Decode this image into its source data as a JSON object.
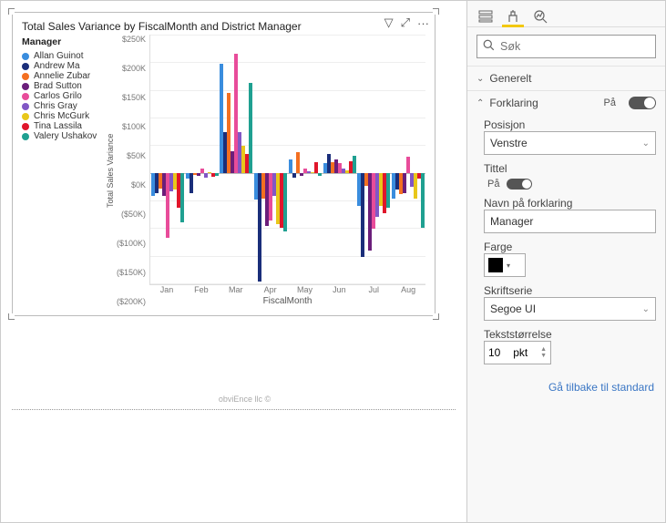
{
  "chart": {
    "title": "Total Sales Variance by FiscalMonth and District Manager",
    "legend_title": "Manager",
    "y_axis_label": "Total Sales Variance",
    "x_axis_label": "FiscalMonth",
    "toolbar": {
      "filter": "▽",
      "focus": "⤢",
      "more": "···"
    },
    "footer": "obviEnce llc ©"
  },
  "chart_data": {
    "type": "bar",
    "categories": [
      "Jan",
      "Feb",
      "Mar",
      "Apr",
      "May",
      "Jun",
      "Jul",
      "Aug"
    ],
    "x_label": "FiscalMonth",
    "y_label": "Total Sales Variance",
    "ylim": [
      -200000,
      250000
    ],
    "y_ticks": [
      "$250K",
      "$200K",
      "$150K",
      "$100K",
      "$50K",
      "$0K",
      "($50K)",
      "($100K)",
      "($150K)",
      "($200K)"
    ],
    "series": [
      {
        "name": "Allan Guinot",
        "color": "#3A8DDE",
        "values": [
          -40000,
          -10000,
          198000,
          -48000,
          25000,
          18000,
          -59000,
          -45000
        ]
      },
      {
        "name": "Andrew Ma",
        "color": "#1A2E7A",
        "values": [
          -35000,
          -35000,
          75000,
          -195000,
          -8000,
          35000,
          -150000,
          -30000
        ]
      },
      {
        "name": "Annelie Zubar",
        "color": "#F36F21",
        "values": [
          -28000,
          -3000,
          145000,
          -45000,
          38000,
          20000,
          -22000,
          -38000
        ]
      },
      {
        "name": "Brad Sutton",
        "color": "#6B1E7A",
        "values": [
          -40000,
          -5000,
          40000,
          -95000,
          -5000,
          25000,
          -140000,
          -35000
        ]
      },
      {
        "name": "Carlos Grilo",
        "color": "#E84C9A",
        "values": [
          -116000,
          8000,
          215000,
          -85000,
          8000,
          18000,
          -100000,
          30000
        ]
      },
      {
        "name": "Chris Gray",
        "color": "#8157C5",
        "values": [
          -32000,
          -8000,
          75000,
          -40000,
          3000,
          8000,
          -78000,
          -25000
        ]
      },
      {
        "name": "Chris McGurk",
        "color": "#E8C71A",
        "values": [
          -30000,
          2000,
          50000,
          -92000,
          2000,
          5000,
          -58000,
          -45000
        ]
      },
      {
        "name": "Tina Lassila",
        "color": "#E0162B",
        "values": [
          -62000,
          -6000,
          35000,
          -98000,
          20000,
          22000,
          -72000,
          -10000
        ]
      },
      {
        "name": "Valery Ushakov",
        "color": "#1FA091",
        "values": [
          -88000,
          -4000,
          163000,
          -105000,
          -5000,
          32000,
          -62000,
          -98000
        ]
      }
    ]
  },
  "panel": {
    "search_placeholder": "Søk",
    "sections": {
      "general": "Generelt",
      "legend": "Forklaring",
      "toggle_on": "På"
    },
    "fields": {
      "position": {
        "label": "Posisjon",
        "value": "Venstre"
      },
      "title": {
        "label": "Tittel",
        "toggle_label": "På"
      },
      "legend_name": {
        "label": "Navn på forklaring",
        "value": "Manager"
      },
      "color": {
        "label": "Farge",
        "value": "#000000"
      },
      "font_family": {
        "label": "Skriftserie",
        "value": "Segoe UI"
      },
      "text_size": {
        "label": "Tekststørrelse",
        "value": "10",
        "unit": "pkt"
      }
    },
    "reset": "Gå tilbake til standard"
  }
}
